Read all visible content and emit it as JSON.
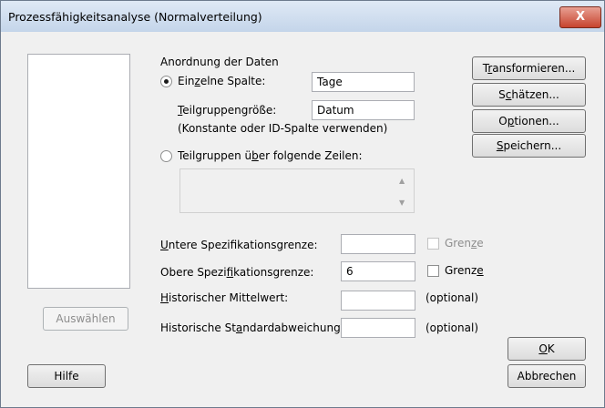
{
  "title": "Prozessfähigkeitsanalyse (Normalverteilung)",
  "close_label": "X",
  "arrangement_label": "Anordnung der Daten",
  "single_column": {
    "pre": "Ein",
    "mn": "z",
    "post": "elne Spalte:",
    "value": "Tage",
    "selected": true
  },
  "subgroup_size": {
    "pre": "",
    "mn": "T",
    "post": "eilgruppengröße:",
    "value": "Datum"
  },
  "hint": "(Konstante oder ID-Spalte verwenden)",
  "subgroups_rows": {
    "pre": "Teilgruppen ü",
    "mn": "b",
    "post": "er folgende Zeilen:",
    "selected": false
  },
  "lower_spec": {
    "pre": "",
    "mn": "U",
    "post": "ntere Spezifikationsgrenze:",
    "value": ""
  },
  "lower_bound": {
    "pre": "Gren",
    "mn": "z",
    "post": "e",
    "checked": false,
    "enabled": false
  },
  "upper_spec": {
    "pre": "Obere Spezi",
    "mn": "f",
    "post": "ikationsgrenze:",
    "value": "6"
  },
  "upper_bound": {
    "pre": "Grenz",
    "mn": "e",
    "post": "",
    "checked": false,
    "enabled": true
  },
  "hist_mean": {
    "pre": "",
    "mn": "H",
    "post": "istorischer Mittelwert:",
    "value": "",
    "note": "(optional)"
  },
  "hist_sd": {
    "pre": "Historische St",
    "mn": "a",
    "post": "ndardabweichung:",
    "value": "",
    "note": "(optional)"
  },
  "buttons": {
    "transform": {
      "pre": "T",
      "mn": "r",
      "post": "ansformieren..."
    },
    "estimate": {
      "pre": "S",
      "mn": "c",
      "post": "hätzen..."
    },
    "options": {
      "pre": "O",
      "mn": "p",
      "post": "tionen..."
    },
    "save": {
      "pre": "",
      "mn": "S",
      "post": "peichern..."
    },
    "select": "Auswählen",
    "help": "Hilfe",
    "ok": {
      "pre": "",
      "mn": "O",
      "post": "K"
    },
    "cancel": "Abbrechen"
  },
  "scroll_up_icon": "▲",
  "scroll_down_icon": "▼"
}
